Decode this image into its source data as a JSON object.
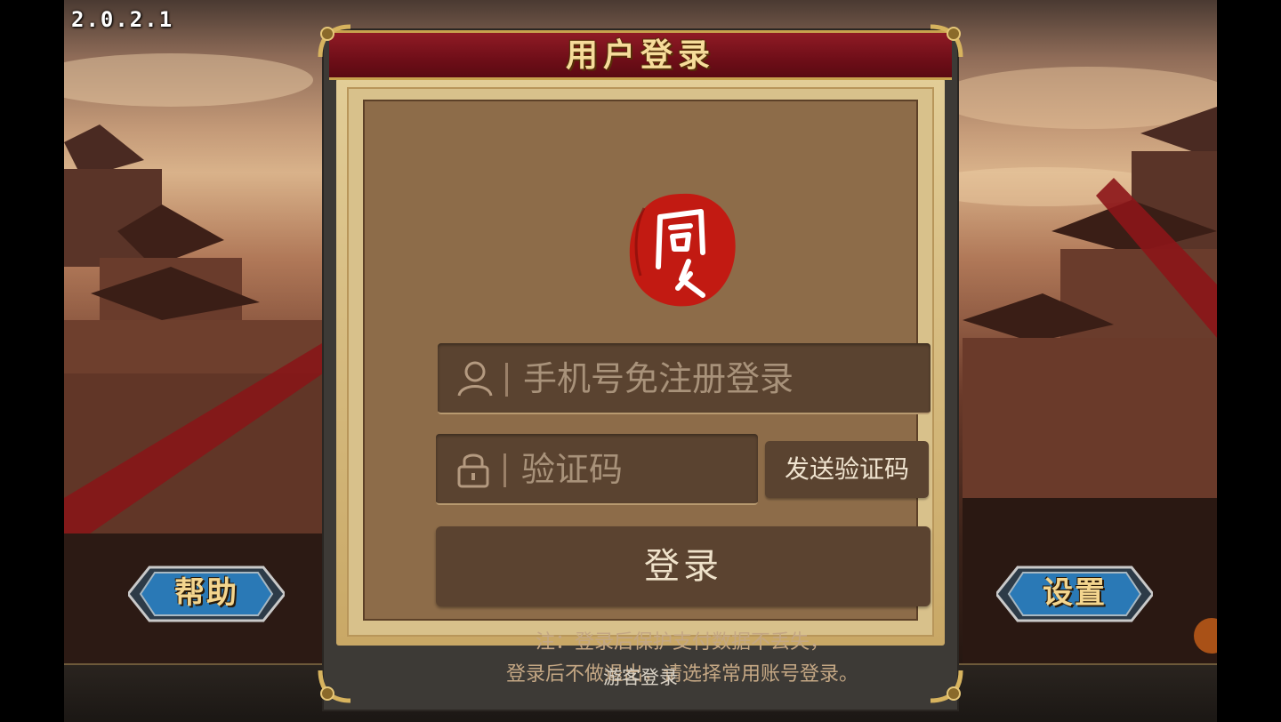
{
  "version": "2.0.2.1",
  "dialog": {
    "title": "用户登录",
    "phone": {
      "placeholder": "手机号免注册登录",
      "value": "",
      "icon": "user-icon"
    },
    "code": {
      "placeholder": "验证码",
      "value": "",
      "icon": "lock-icon"
    },
    "send_code_label": "发送验证码",
    "login_label": "登录",
    "note_line1": "注：登录后保护支付数据不丢失，",
    "note_line2": "登录后不做退出，请选择常用账号登录。",
    "guest_label": "游客登录"
  },
  "side_buttons": {
    "help_label": "帮助",
    "settings_label": "设置"
  },
  "colors": {
    "title_bar": "#7a1520",
    "title_text": "#f6dc9a",
    "panel": "#8d6c49",
    "field": "#5a4330",
    "seal": "#c21a12"
  }
}
